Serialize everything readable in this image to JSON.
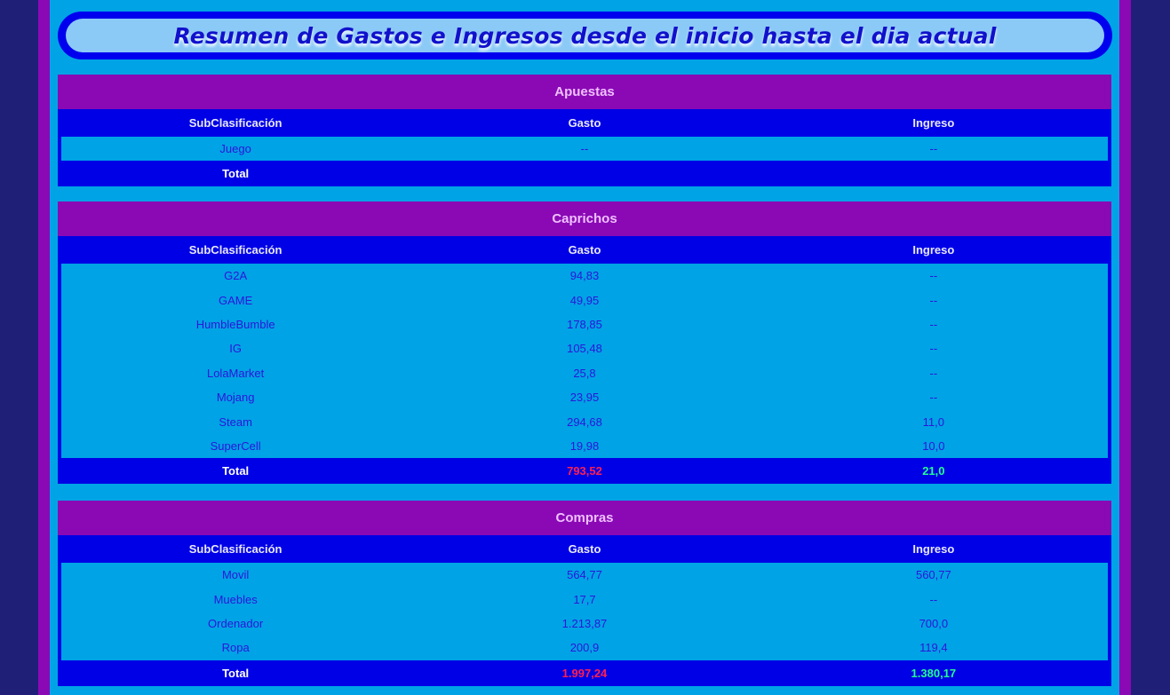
{
  "page_title": "Resumen de Gastos e Ingresos desde el inicio hasta el dia actual",
  "colors": {
    "background": "#1f1f78",
    "frame": "#8a09b5",
    "content": "#00a3e6",
    "table_header": "#0000e6",
    "negative_total": "#ff2050",
    "positive_total": "#20ff90"
  },
  "sections": [
    {
      "name": "Apuestas",
      "headers": [
        "SubClasificación",
        "Gasto",
        "Ingreso"
      ],
      "rows": [
        {
          "sub": "Juego",
          "gasto": "--",
          "ingreso": "--"
        }
      ],
      "total": {
        "label": "Total",
        "gasto": "",
        "ingreso": ""
      }
    },
    {
      "name": "Caprichos",
      "headers": [
        "SubClasificación",
        "Gasto",
        "Ingreso"
      ],
      "rows": [
        {
          "sub": "G2A",
          "gasto": "94,83",
          "ingreso": "--"
        },
        {
          "sub": "GAME",
          "gasto": "49,95",
          "ingreso": "--"
        },
        {
          "sub": "HumbleBumble",
          "gasto": "178,85",
          "ingreso": "--"
        },
        {
          "sub": "IG",
          "gasto": "105,48",
          "ingreso": "--"
        },
        {
          "sub": "LolaMarket",
          "gasto": "25,8",
          "ingreso": "--"
        },
        {
          "sub": "Mojang",
          "gasto": "23,95",
          "ingreso": "--"
        },
        {
          "sub": "Steam",
          "gasto": "294,68",
          "ingreso": "11,0"
        },
        {
          "sub": "SuperCell",
          "gasto": "19,98",
          "ingreso": "10,0"
        }
      ],
      "total": {
        "label": "Total",
        "gasto": "793,52",
        "ingreso": "21,0"
      }
    },
    {
      "name": "Compras",
      "headers": [
        "SubClasificación",
        "Gasto",
        "Ingreso"
      ],
      "rows": [
        {
          "sub": "Movil",
          "gasto": "564,77",
          "ingreso": "560,77"
        },
        {
          "sub": "Muebles",
          "gasto": "17,7",
          "ingreso": "--"
        },
        {
          "sub": "Ordenador",
          "gasto": "1.213,87",
          "ingreso": "700,0"
        },
        {
          "sub": "Ropa",
          "gasto": "200,9",
          "ingreso": "119,4"
        }
      ],
      "total": {
        "label": "Total",
        "gasto": "1.997,24",
        "ingreso": "1.380,17"
      }
    }
  ]
}
